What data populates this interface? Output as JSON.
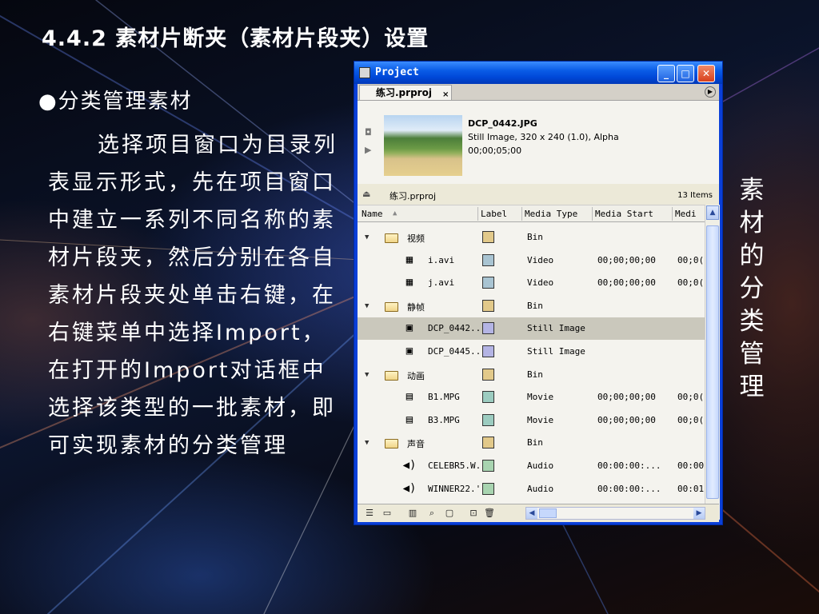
{
  "slide": {
    "title": "4.4.2 素材片断夹（素材片段夹）设置",
    "bullet": "●分类管理素材",
    "body": "选择项目窗口为目录列表显示形式，先在项目窗口中建立一系列不同名称的素材片段夹，然后分别在各自素材片段夹处单击右键，在右键菜单中选择Import，在打开的Import对话框中选择该类型的一批素材，即可实现素材的分类管理",
    "side_caption": "素材的分类管理"
  },
  "window": {
    "title": "Project",
    "tab_label": "练习.prproj",
    "tab_close": "×",
    "preview": {
      "file_name": "DCP_0442.JPG",
      "details": "Still Image, 320 x 240 (1.0), Alpha",
      "duration": "00;00;05;00"
    },
    "project_name": "练习.prproj",
    "item_count": "13 Items",
    "columns": {
      "name": "Name",
      "label": "Label",
      "media_type": "Media Type",
      "media_start": "Media Start",
      "media_end": "Medi"
    },
    "rows": [
      {
        "kind": "bin",
        "name": "视频",
        "color": "#e2c98a",
        "type": "Bin",
        "start": "",
        "end": ""
      },
      {
        "kind": "video",
        "name": "i.avi",
        "color": "#a9c4d2",
        "type": "Video",
        "start": "00;00;00;00",
        "end": "00;0("
      },
      {
        "kind": "video",
        "name": "j.avi",
        "color": "#a9c4d2",
        "type": "Video",
        "start": "00;00;00;00",
        "end": "00;0("
      },
      {
        "kind": "bin",
        "name": "静帧",
        "color": "#e2c98a",
        "type": "Bin",
        "start": "",
        "end": ""
      },
      {
        "kind": "still",
        "name": "DCP_0442..",
        "color": "#b4b4e4",
        "type": "Still Image",
        "start": "",
        "end": "",
        "selected": true
      },
      {
        "kind": "still",
        "name": "DCP_0445..",
        "color": "#b4b4e4",
        "type": "Still Image",
        "start": "",
        "end": ""
      },
      {
        "kind": "bin",
        "name": "动画",
        "color": "#e2c98a",
        "type": "Bin",
        "start": "",
        "end": ""
      },
      {
        "kind": "movie",
        "name": "B1.MPG",
        "color": "#9cccc0",
        "type": "Movie",
        "start": "00;00;00;00",
        "end": "00;0("
      },
      {
        "kind": "movie",
        "name": "B3.MPG",
        "color": "#9cccc0",
        "type": "Movie",
        "start": "00;00;00;00",
        "end": "00;0("
      },
      {
        "kind": "bin",
        "name": "声音",
        "color": "#e2c98a",
        "type": "Bin",
        "start": "",
        "end": ""
      },
      {
        "kind": "audio",
        "name": "CELEBR5.W.",
        "color": "#a8d4b0",
        "type": "Audio",
        "start": "00:00:00:...",
        "end": "00:00"
      },
      {
        "kind": "audio",
        "name": "WINNER22.'",
        "color": "#a8d4b0",
        "type": "Audio",
        "start": "00:00:00:...",
        "end": "00:01"
      }
    ]
  }
}
